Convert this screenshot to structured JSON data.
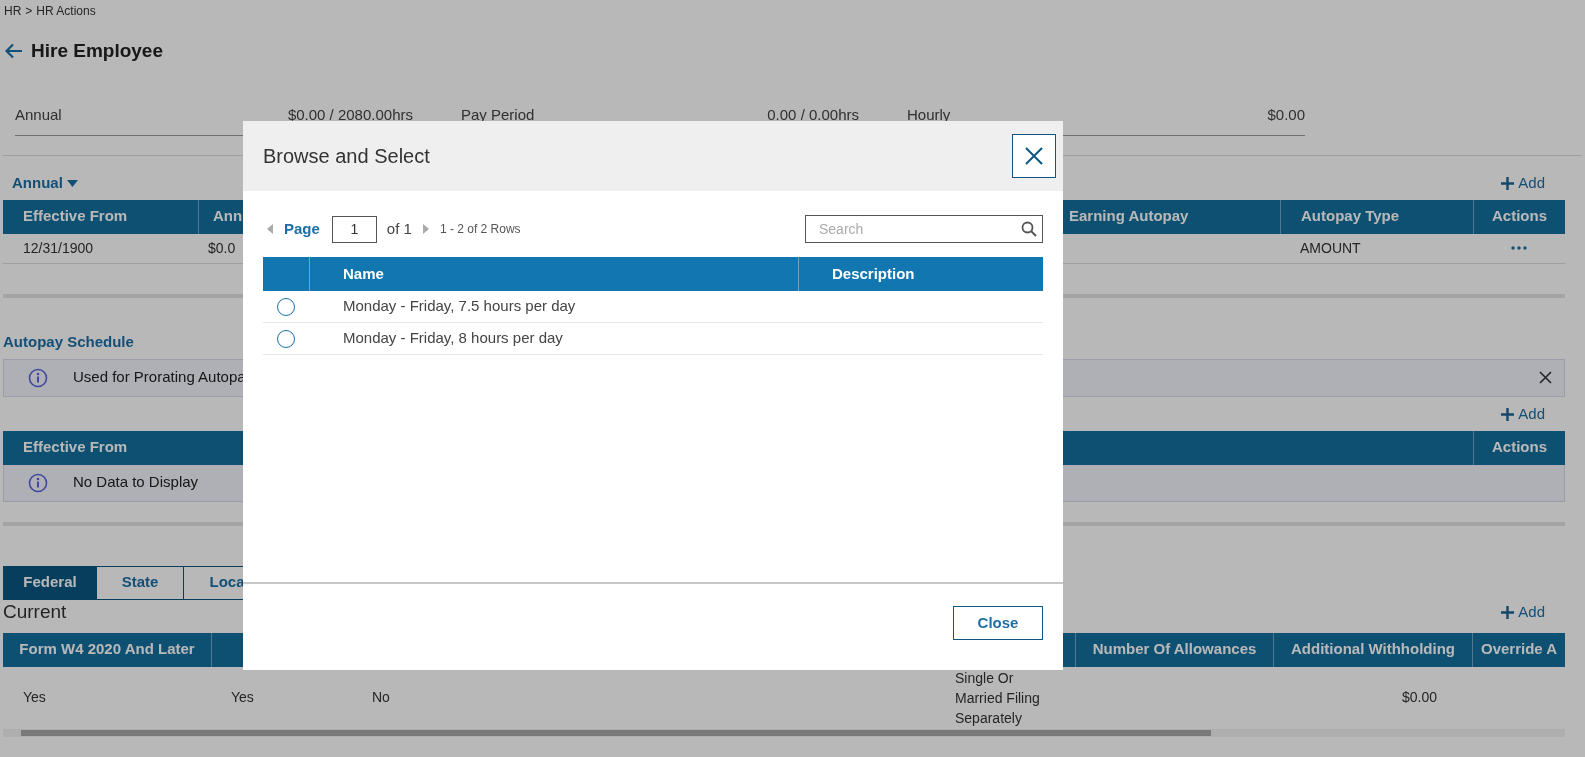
{
  "breadcrumb": {
    "items": [
      "HR",
      "HR Actions"
    ],
    "separator": ">"
  },
  "page_title": "Hire Employee",
  "summary": [
    {
      "label": "Annual",
      "value": "$0.00 / 2080.00hrs"
    },
    {
      "label": "Pay Period",
      "value": "0.00 / 0.00hrs"
    },
    {
      "label": "Hourly",
      "value": "$0.00"
    }
  ],
  "autopay": {
    "dropdown": "Annual",
    "add": "Add",
    "columns": [
      "Effective From",
      "Ann",
      "Earning Autopay",
      "Autopay Type",
      "Actions"
    ],
    "rows": [
      {
        "effective_from": "12/31/1900",
        "amount": "$0.0",
        "autopay_type": "AMOUNT"
      }
    ]
  },
  "autopay_schedule": {
    "title": "Autopay Schedule",
    "info": "Used for Prorating Autopa",
    "add": "Add",
    "columns": [
      "Effective From",
      "Actions"
    ],
    "empty_message": "No Data to Display"
  },
  "tax": {
    "tabs": [
      {
        "label": "Federal",
        "selected": true
      },
      {
        "label": "State",
        "selected": false
      },
      {
        "label": "Loca",
        "selected": false
      }
    ],
    "section_title": "Current",
    "add": "Add",
    "columns": [
      "Form W4 2020 And Later",
      null,
      null,
      null,
      null,
      null,
      null,
      "Number Of Allowances",
      "Additional Withholding",
      "Override A"
    ],
    "rows": [
      [
        "Yes",
        "Yes",
        "No",
        null,
        null,
        null,
        "Single Or Married Filing Separately",
        null,
        "$0.00",
        null
      ]
    ]
  },
  "modal": {
    "title": "Browse and Select",
    "pager": {
      "label": "Page",
      "page": "1",
      "of": "of 1",
      "rows_info": "1 - 2 of 2 Rows"
    },
    "search": {
      "placeholder": "Search"
    },
    "columns": [
      "Name",
      "Description"
    ],
    "rows": [
      {
        "name": "Monday - Friday, 7.5 hours per day",
        "selected": false
      },
      {
        "name": "Monday - Friday, 8 hours per day",
        "selected": false
      }
    ],
    "close_button": "Close"
  }
}
